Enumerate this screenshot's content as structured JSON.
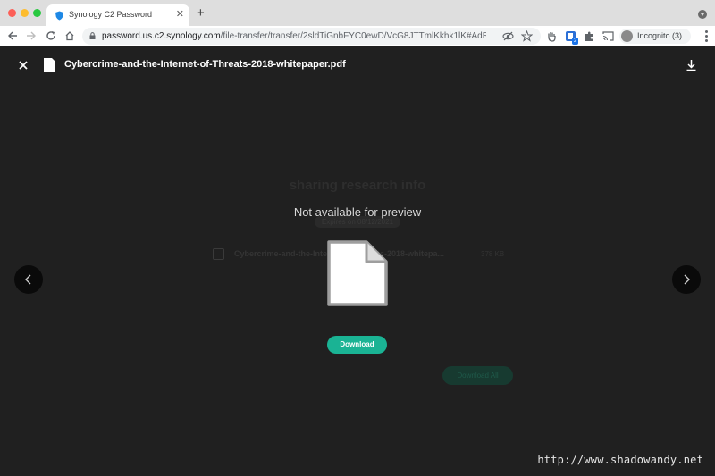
{
  "browser": {
    "tab_title": "Synology C2 Password",
    "new_tab_label": "+",
    "url_host": "password.us.c2.synology.com",
    "url_path": "/file-transfer/transfer/2sldTiGnbFYC0ewD/VcG8JTTmlKkhk1lK#AdRjlc...",
    "extension_badge": "2",
    "profile_label": "Incognito (3)"
  },
  "background_page": {
    "share_title": "sharing research info",
    "expires": "Expires on 08/12/2021",
    "file_name": "Cybercrime-and-the-Internet-of-Threats-2018-whitepa...",
    "file_size": "378 KB",
    "download_all_label": "Download All"
  },
  "viewer": {
    "file_name": "Cybercrime-and-the-Internet-of-Threats-2018-whitepaper.pdf",
    "preview_message": "Not available for preview",
    "download_label": "Download"
  },
  "watermark": "http://www.shadowandy.net",
  "icons": {
    "close": "close-icon",
    "file": "file-icon",
    "download": "download-icon",
    "prev": "chevron-left-icon",
    "next": "chevron-right-icon"
  },
  "colors": {
    "accent": "#1ab394",
    "overlay_bg": "#202020"
  }
}
